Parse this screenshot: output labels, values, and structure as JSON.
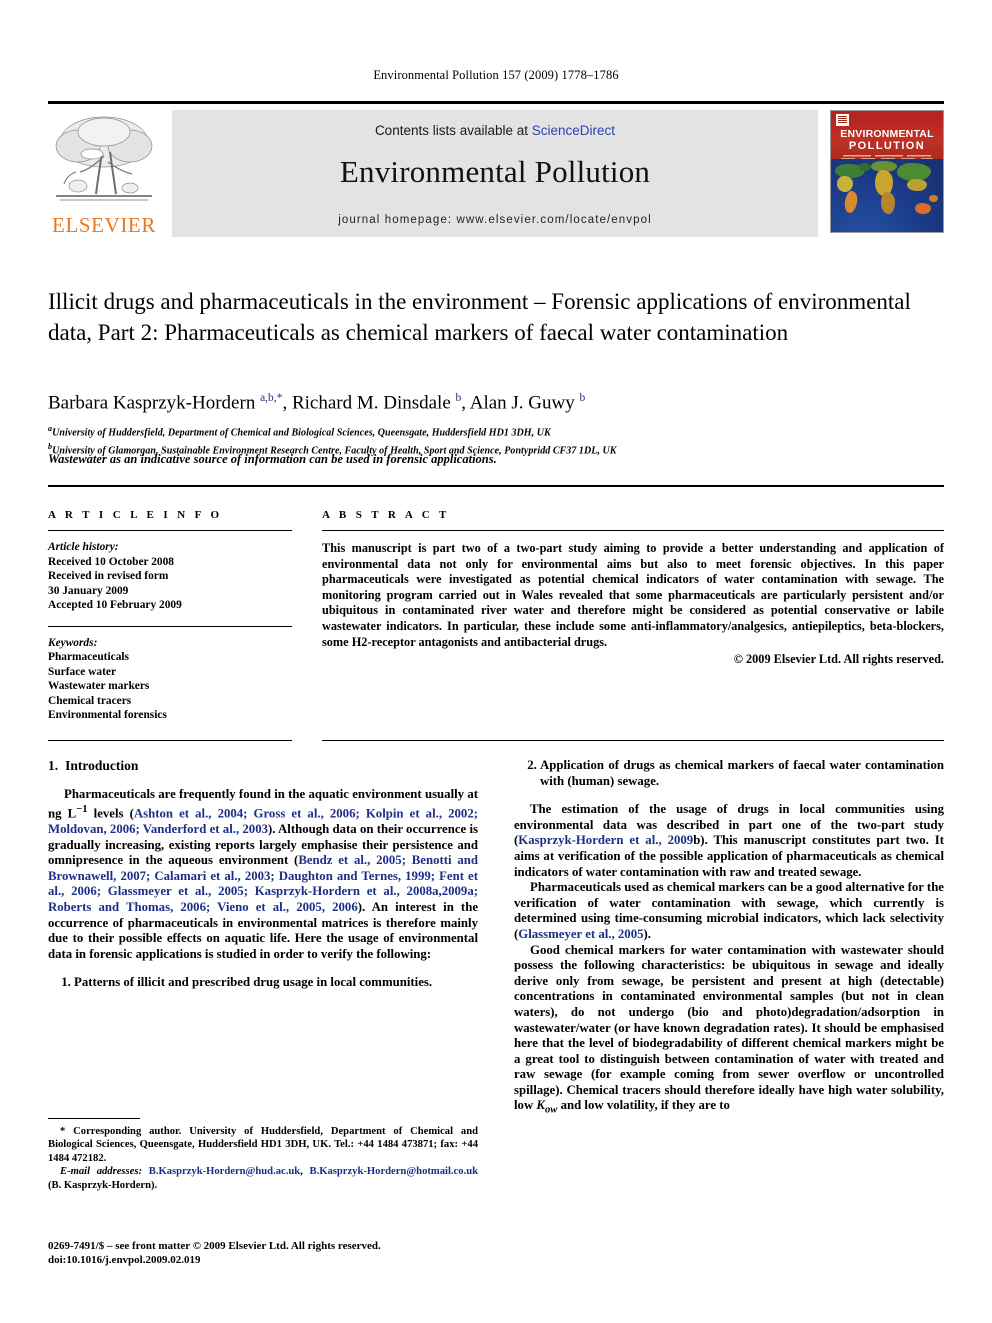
{
  "running_head": "Environmental Pollution 157 (2009) 1778–1786",
  "masthead": {
    "contents_prefix": "Contents lists available at ",
    "sciencedirect": "ScienceDirect",
    "journal_title": "Environmental Pollution",
    "homepage": "journal homepage: www.elsevier.com/locate/envpol",
    "publisher_logo_text": "ELSEVIER",
    "cover": {
      "line1": "ENVIRONMENTAL",
      "line2": "POLLUTION"
    },
    "link_color": "#2a42b4",
    "logo_color": "#E87722",
    "banner_bg": "#e3e3e3"
  },
  "article": {
    "title": "Illicit drugs and pharmaceuticals in the environment – Forensic applications of environmental data, Part 2: Pharmaceuticals as chemical markers of faecal water contamination",
    "authors_html": "Barbara Kasprzyk-Hordern <sup>a,b,</sup><sup>*</sup>, Richard M. Dinsdale <sup>b</sup>, Alan J. Guwy <sup>b</sup>",
    "affiliation_a": "University of Huddersfield, Department of Chemical and Biological Sciences, Queensgate, Huddersfield HD1 3DH, UK",
    "affiliation_b": "University of Glamorgan, Sustainable Environment Research Centre, Faculty of Health, Sport and Science, Pontypridd CF37 1DL, UK",
    "highlight": "Wastewater as an indicative source of information can be used in forensic applications."
  },
  "article_info": {
    "heading": "A R T I C L E   I N F O",
    "history_label": "Article history:",
    "history": [
      "Received 10 October 2008",
      "Received in revised form",
      "30 January 2009",
      "Accepted 10 February 2009"
    ],
    "keywords_label": "Keywords:",
    "keywords": [
      "Pharmaceuticals",
      "Surface water",
      "Wastewater markers",
      "Chemical tracers",
      "Environmental forensics"
    ]
  },
  "abstract": {
    "heading": "A B S T R A C T",
    "text": "This manuscript is part two of a two-part study aiming to provide a better understanding and application of environmental data not only for environmental aims but also to meet forensic objectives. In this paper pharmaceuticals were investigated as potential chemical indicators of water contamination with sewage. The monitoring program carried out in Wales revealed that some pharmaceuticals are particularly persistent and/or ubiquitous in contaminated river water and therefore might be considered as potential conservative or labile wastewater indicators. In particular, these include some anti-inflammatory/analgesics, antiepileptics, beta-blockers, some H2-receptor antagonists and antibacterial drugs.",
    "copyright": "© 2009 Elsevier Ltd. All rights reserved."
  },
  "body": {
    "left": {
      "section_number": "1.",
      "section_title": "Introduction",
      "para1_parts": [
        {
          "t": "Pharmaceuticals are frequently found in the aquatic environment usually at ng L",
          "k": "plain"
        },
        {
          "t": "−1",
          "k": "sup"
        },
        {
          "t": " levels (",
          "k": "plain"
        },
        {
          "t": "Ashton et al., 2004; Gross et al., 2006; Kolpin et al., 2002; Moldovan, 2006; Vanderford et al., 2003",
          "k": "ref"
        },
        {
          "t": "). Although data on their occurrence is gradually increasing, existing reports largely emphasise their persistence and omnipresence in the aqueous environment (",
          "k": "plain"
        },
        {
          "t": "Bendz et al., 2005; Benotti and Brownawell, 2007; Calamari et al., 2003; Daughton and Ternes, 1999; Fent et al., 2006; Glassmeyer et al., 2005; Kasprzyk-Hordern et al., 2008a,2009a; Roberts and Thomas, 2006; Vieno et al., 2005, 2006",
          "k": "ref"
        },
        {
          "t": "). An interest in the occurrence of pharmaceuticals in environmental matrices is therefore mainly due to their possible effects on aquatic life. Here the usage of environmental data in forensic applications is studied in order to verify the following:",
          "k": "plain"
        }
      ],
      "list_item_1": "Patterns of illicit and prescribed drug usage in local communities."
    },
    "right": {
      "list_item_2": "Application of drugs as chemical markers of faecal water contamination with (human) sewage.",
      "para2_parts": [
        {
          "t": "The estimation of the usage of drugs in local communities using environmental data was described in part one of the two-part study (",
          "k": "plain"
        },
        {
          "t": "Kasprzyk-Hordern et al., 2009",
          "k": "ref"
        },
        {
          "t": "b). This manuscript constitutes part two. It aims at verification of the possible application of pharmaceuticals as chemical indicators of water contamination with raw and treated sewage.",
          "k": "plain"
        }
      ],
      "para3_parts": [
        {
          "t": "Pharmaceuticals used as chemical markers can be a good alternative for the verification of water contamination with sewage, which currently is determined using time-consuming microbial indicators, which lack selectivity (",
          "k": "plain"
        },
        {
          "t": "Glassmeyer et al., 2005",
          "k": "ref"
        },
        {
          "t": ").",
          "k": "plain"
        }
      ],
      "para4_parts": [
        {
          "t": "Good chemical markers for water contamination with wastewater should possess the following characteristics: be ubiquitous in sewage and ideally derive only from sewage, be persistent and present at high (detectable) concentrations in contaminated environmental samples (but not in clean waters), do not undergo (bio and photo)degradation/adsorption in wastewater/water (or have known degradation rates). It should be emphasised here that the level of biodegradability of different chemical markers might be a great tool to distinguish between contamination of water with treated and raw sewage (for example coming from sewer overflow or uncontrolled spillage). Chemical tracers should therefore ideally have high water solubility, low ",
          "k": "plain"
        },
        {
          "t": "K",
          "k": "ital"
        },
        {
          "t": "ow",
          "k": "sub-ital"
        },
        {
          "t": " and low volatility, if they are to",
          "k": "plain"
        }
      ]
    }
  },
  "footnotes": {
    "corresponding": "* Corresponding author. University of Huddersfield, Department of Chemical and Biological Sciences, Queensgate, Huddersfield HD1 3DH, UK. Tel.: +44 1484 473871; fax: +44 1484 472182.",
    "email_label": "E-mail addresses:",
    "email_1": "B.Kasprzyk-Hordern@hud.ac.uk",
    "email_2": "B.Kasprzyk-Hordern@hotmail.co.uk",
    "email_author": " (B. Kasprzyk-Hordern)."
  },
  "imprint": {
    "line1": "0269-7491/$ – see front matter © 2009 Elsevier Ltd. All rights reserved.",
    "line2": "doi:10.1016/j.envpol.2009.02.019"
  }
}
